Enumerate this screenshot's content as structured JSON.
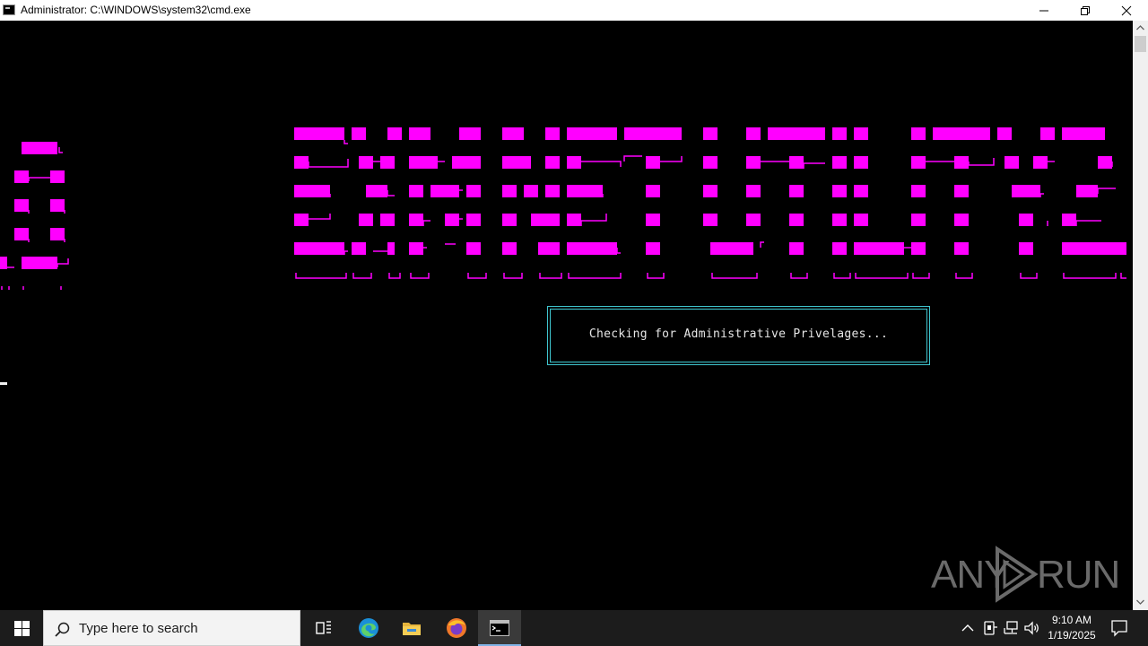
{
  "window": {
    "title": "Administrator: C:\\WINDOWS\\system32\\cmd.exe",
    "minimize_icon": "minimize-icon",
    "maximize_icon": "restore-icon",
    "close_icon": "close-icon"
  },
  "console": {
    "banner_color": "#ff00ff",
    "border_color": "#3fc6cf",
    "dialog_message": "Checking for Administrative Privelages..."
  },
  "watermark": {
    "left": "ANY",
    "right": "RUN"
  },
  "taskbar": {
    "search_placeholder": "Type here to search",
    "time": "9:10 AM",
    "date": "1/19/2025",
    "pinned": [
      "task-view-icon",
      "edge-icon",
      "file-explorer-icon",
      "firefox-icon",
      "cmd-icon"
    ]
  }
}
